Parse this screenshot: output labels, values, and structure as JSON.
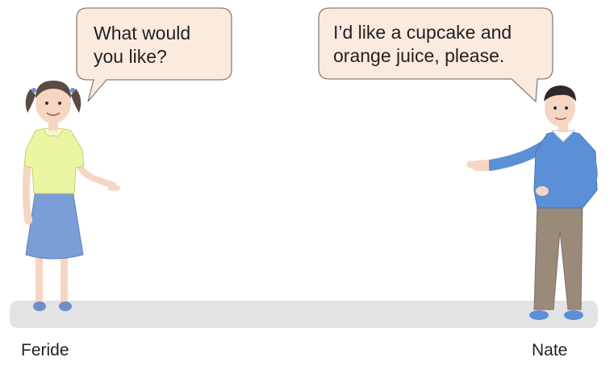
{
  "speech": {
    "feride_bubble": "What would\nyou like?",
    "nate_bubble": "I’d like a cupcake and\norange juice, please."
  },
  "characters": {
    "left_name": "Feride",
    "right_name": "Nate"
  },
  "colors": {
    "bubble_fill": "#fbebdf",
    "bubble_stroke": "#8a7f78",
    "floor": "#e2e3e5",
    "feride_shirt": "#eef5a2",
    "feride_skirt": "#7b9ed6",
    "nate_sweater": "#5b8fd6",
    "nate_trousers": "#9a8a7a",
    "skin": "#f6d6c2",
    "hair": "#5a4a42"
  }
}
